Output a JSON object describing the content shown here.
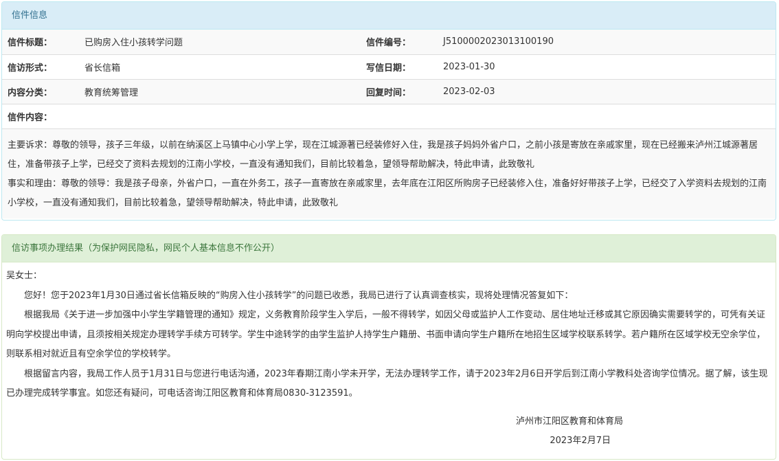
{
  "letter_panel": {
    "heading": "信件信息",
    "rows": [
      {
        "label1": "信件标题：",
        "value1": "已购房入住小孩转学问题",
        "label2": "信件编号：",
        "value2": "J5100002023013100190"
      },
      {
        "label1": "信访形式：",
        "value1": "省长信箱",
        "label2": "写信日期：",
        "value2": "2023-01-30"
      },
      {
        "label1": "内容分类：",
        "value1": "教育统筹管理",
        "label2": "回复时间：",
        "value2": "2023-02-03"
      }
    ],
    "content_label": "信件内容：",
    "content_paragraphs": [
      "主要诉求：尊敬的领导，孩子三年级，以前在纳溪区上马镇中心小学上学，现在江城源著已经装修好入住，我是孩子妈妈外省户口，之前小孩是寄放在亲戚家里，现在已经搬来泸州江城源著居住，准备带孩子上学，已经交了资料去规划的江南小学校，一直没有通知我们，目前比较着急，望领导帮助解决，特此申请，此致敬礼",
      "事实和理由：尊敬的领导：我是孩子母亲，外省户口，一直在外务工，孩子一直寄放在亲戚家里，去年底在江阳区所购房子已经装修入住，准备好好带孩子上学，已经交了入学资料去规划的江南小学校，一直没有通知我们，目前比较着急，望领导帮助解决，特此申请，此致敬礼"
    ]
  },
  "result_panel": {
    "heading": "信访事项办理结果（为保护网民隐私，网民个人基本信息不作公开）",
    "salutation": "吴女士：",
    "paragraphs": [
      "您好！您于2023年1月30日通过省长信箱反映的“购房入住小孩转学”的问题已收悉，我局已进行了认真调查核实，现将处理情况答复如下：",
      "根据我局《关于进一步加强中小学生学籍管理的通知》规定，义务教育阶段学生入学后，一般不得转学，如因父母或监护人工作变动、居住地址迁移或其它原因确实需要转学的，可凭有关证明向学校提出申请，且须按相关规定办理转学手续方可转学。学生中途转学的由学生监护人持学生户籍册、书面申请向学生户籍所在地招生区域学校联系转学。若户籍所在区域学校无空余学位，则联系相对就近且有空余学位的学校转学。",
      "根据留言内容，我局工作人员于1月31日与您进行电话沟通，2023年春期江南小学未开学，无法办理转学工作，请于2023年2月6日开学后到江南小学教科处咨询学位情况。据了解，该生现已办理完成转学事宜。如您还有疑问，可电话咨询江阳区教育和体育局0830-3123591。"
    ],
    "signature_org": "泸州市江阳区教育和体育局",
    "signature_date": "2023年2月7日"
  }
}
